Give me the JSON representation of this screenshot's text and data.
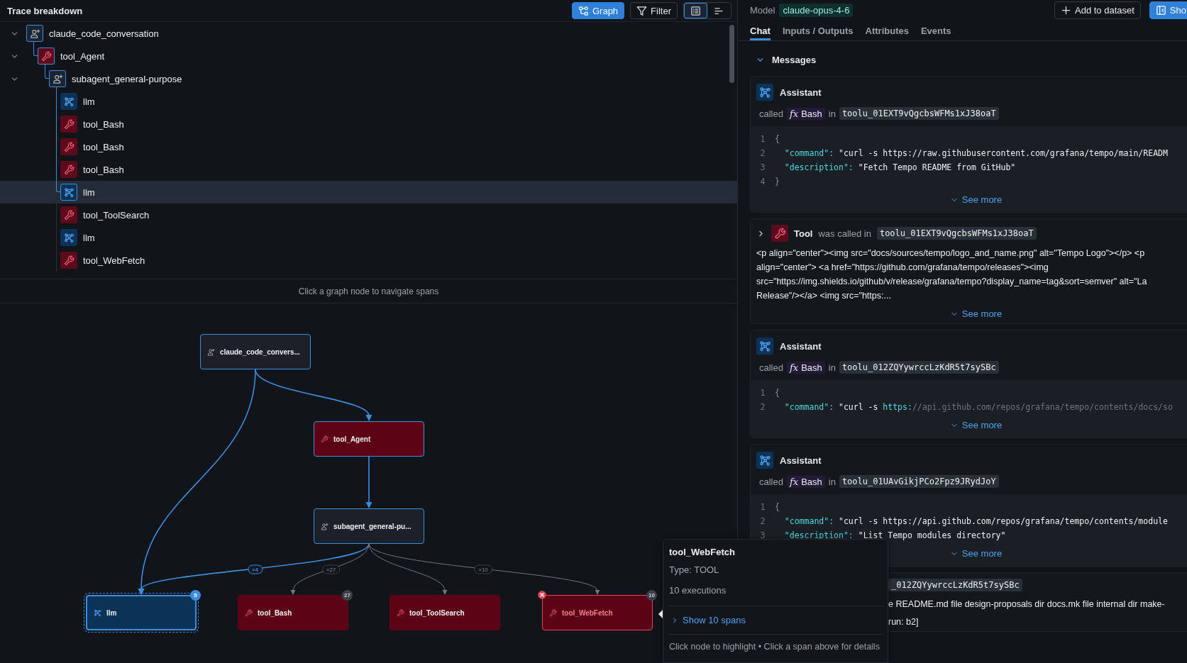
{
  "trace_panel": {
    "title": "Trace breakdown",
    "view_buttons": [
      {
        "kind": "graph",
        "label": "Graph",
        "active": true
      },
      {
        "kind": "filter",
        "label": "Filter",
        "active": false
      }
    ],
    "layout_toggle": [
      {
        "kind": "list",
        "selected": true
      },
      {
        "kind": "timeline",
        "selected": false
      }
    ]
  },
  "span_tree": [
    {
      "kind": "agent",
      "name": "claude_code_conversation",
      "expanded": true,
      "selected": false,
      "children": [
        {
          "kind": "tool",
          "name": "tool_Agent",
          "expanded": true,
          "selected": false,
          "children": [
            {
              "kind": "agent",
              "name": "subagent_general-purpose",
              "expanded": true,
              "selected": false,
              "children": [
                {
                  "kind": "llm",
                  "name": "llm",
                  "selected": false
                },
                {
                  "kind": "tool",
                  "name": "tool_Bash",
                  "selected": false
                },
                {
                  "kind": "tool",
                  "name": "tool_Bash",
                  "selected": false
                },
                {
                  "kind": "tool",
                  "name": "tool_Bash",
                  "selected": false
                },
                {
                  "kind": "llm",
                  "name": "llm",
                  "selected": true
                },
                {
                  "kind": "tool",
                  "name": "tool_ToolSearch",
                  "selected": false
                },
                {
                  "kind": "llm",
                  "name": "llm",
                  "selected": false
                },
                {
                  "kind": "tool",
                  "name": "tool_WebFetch",
                  "selected": false
                }
              ]
            }
          ]
        }
      ]
    }
  ],
  "graph_hint": "Click a graph node to navigate spans",
  "graph": {
    "nodes": [
      {
        "kind": "agent",
        "label": "claude_code_convers...",
        "highlighted": true,
        "selected": false,
        "error": false
      },
      {
        "kind": "tool",
        "label": "tool_Agent",
        "highlighted": true,
        "selected": false,
        "error": false
      },
      {
        "kind": "agent",
        "label": "subagent_general-pu...",
        "highlighted": true,
        "selected": false,
        "error": false
      },
      {
        "kind": "llm",
        "label": "llm",
        "highlighted": true,
        "selected": true,
        "error": false,
        "count": "5"
      },
      {
        "kind": "tool",
        "label": "tool_Bash",
        "highlighted": false,
        "selected": false,
        "error": false,
        "count": "27"
      },
      {
        "kind": "tool",
        "label": "tool_ToolSearch",
        "highlighted": false,
        "selected": false,
        "error": false
      },
      {
        "kind": "tool",
        "label": "tool_WebFetch",
        "highlighted": false,
        "selected": false,
        "error": true,
        "count": "10"
      }
    ],
    "edges": [
      {
        "highlighted": true
      },
      {
        "highlighted": true
      },
      {
        "highlighted": true
      },
      {
        "highlighted": true,
        "label": "×4"
      },
      {
        "highlighted": false,
        "label": "×27"
      },
      {
        "highlighted": false
      },
      {
        "highlighted": false,
        "label": "×10"
      }
    ]
  },
  "tooltip": {
    "title": "tool_WebFetch",
    "type": "Type: TOOL",
    "executions": "10 executions",
    "link": "Show 10 spans",
    "hint": "Click node to highlight • Click a span above for details"
  },
  "detail": {
    "model_label": "Model",
    "model": "claude-opus-4-6",
    "buttons": [
      {
        "kind": "add",
        "label": "Add to dataset"
      },
      {
        "kind": "panel",
        "label": "Sho"
      }
    ],
    "tabs": [
      {
        "label": "Chat",
        "selected": true
      },
      {
        "label": "Inputs / Outputs",
        "selected": false
      },
      {
        "label": "Attributes",
        "selected": false
      },
      {
        "label": "Events",
        "selected": false
      }
    ],
    "section": {
      "title": "Messages",
      "expanded": true
    },
    "messages": [
      {
        "kind": "assistant",
        "label": "Assistant",
        "called": "called",
        "function_symbol": "fx",
        "tool": "Bash",
        "in": "in",
        "call_id": "toolu_01EXT9vQgcbsWFMs1xJ38oaT",
        "code": [
          {
            "number": "1",
            "tokens": [
              {
                "kind": "punct",
                "text": "{"
              }
            ]
          },
          {
            "number": "2",
            "tokens": [
              {
                "kind": "key",
                "text": "  \"command\":"
              },
              {
                "kind": "string",
                "text": " \"curl -s https://raw.githubusercontent.com/grafana/tempo/main/READM"
              }
            ]
          },
          {
            "number": "3",
            "tokens": [
              {
                "kind": "key",
                "text": "  \"description\":"
              },
              {
                "kind": "string",
                "text": " \"Fetch Tempo README from GitHub\""
              }
            ]
          },
          {
            "number": "4",
            "tokens": [
              {
                "kind": "punct",
                "text": "}"
              }
            ]
          }
        ],
        "see_more": "See more"
      },
      {
        "kind": "tool",
        "expanded": false,
        "label": "Tool",
        "called": "was called in",
        "call_id": "toolu_01EXT9vQgcbsWFMs1xJ38oaT",
        "body": [
          "<p align=\"center\"><img src=\"docs/sources/tempo/logo_and_name.png\" alt=\"Tempo Logo\"></p> <p",
          "align=\"center\"> <a href=\"https://github.com/grafana/tempo/releases\"><img",
          "src=\"https://img.shields.io/github/v/release/grafana/tempo?display_name=tag&sort=semver\" alt=\"La",
          "Release\"/></a> <img src=\"https:..."
        ],
        "see_more": "See more"
      },
      {
        "kind": "assistant",
        "label": "Assistant",
        "called": "called",
        "function_symbol": "fx",
        "tool": "Bash",
        "in": "in",
        "call_id": "toolu_012ZQYywrccLzKdR5t7sySBc",
        "code": [
          {
            "number": "1",
            "tokens": [
              {
                "kind": "punct",
                "text": "{"
              }
            ]
          },
          {
            "number": "2",
            "tokens": [
              {
                "kind": "key",
                "text": "  \"command\":"
              },
              {
                "kind": "string",
                "text": " \"curl -s "
              },
              {
                "kind": "link",
                "text": "https:"
              },
              {
                "kind": "dim",
                "text": "//api.github.com/repos/grafana/tempo/contents/docs/so"
              }
            ]
          }
        ],
        "see_more": "See more"
      },
      {
        "kind": "assistant",
        "label": "Assistant",
        "called": "called",
        "function_symbol": "fx",
        "tool": "Bash",
        "in": "in",
        "call_id": "toolu_01UAvGikjPCo2Fpz9JRydJoY",
        "code": [
          {
            "number": "1",
            "tokens": [
              {
                "kind": "punct",
                "text": "{"
              }
            ]
          },
          {
            "number": "2",
            "tokens": [
              {
                "kind": "key",
                "text": "  \"command\":"
              },
              {
                "kind": "string",
                "text": " \"curl -s https://api.github.com/repos/grafana/tempo/contents/module"
              }
            ]
          },
          {
            "number": "3",
            "tokens": [
              {
                "kind": "key",
                "text": "  \"description\":"
              },
              {
                "kind": "string",
                "text": " \"List Tempo modules directory\""
              }
            ]
          }
        ],
        "see_more": "See more"
      },
      {
        "kind": "tool",
        "call_id": "_012ZQYywrccLzKdR5t7sySBc",
        "body": [
          "e README.md file design-proposals dir docs.mk file internal dir make-",
          "run: b2]"
        ]
      }
    ]
  }
}
